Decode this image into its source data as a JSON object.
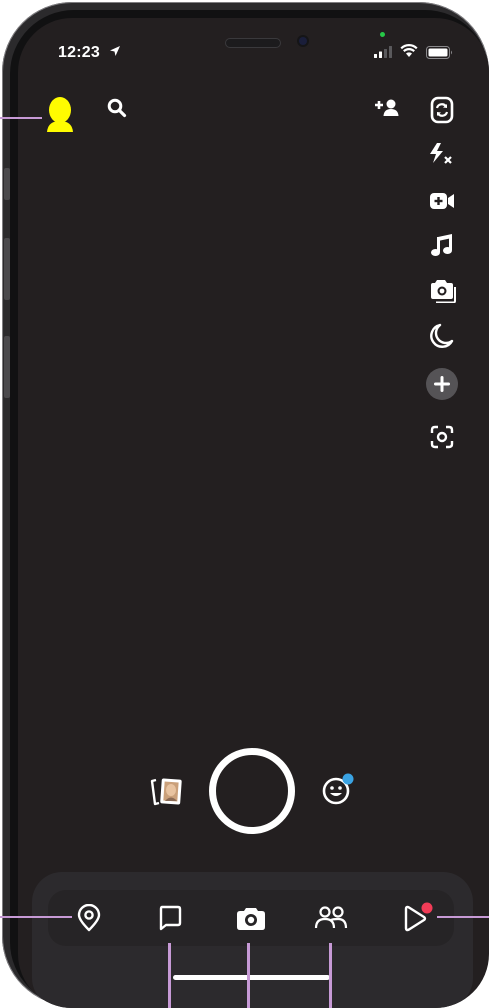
{
  "status_bar": {
    "time": "12:23",
    "icons": [
      "location-arrow-icon",
      "signal-icon",
      "wifi-icon",
      "battery-icon"
    ]
  },
  "header": {
    "icons": [
      "bitmoji-avatar-icon",
      "search-icon",
      "add-friend-icon"
    ]
  },
  "camera_toolbar": {
    "icons": [
      "flip-camera-icon",
      "flash-off-icon",
      "video-chat-icon",
      "music-icon",
      "multi-capture-icon",
      "night-mode-icon",
      "more-plus-icon",
      "scan-icon"
    ]
  },
  "capture_row": {
    "icons": [
      "memories-icon",
      "shutter-button",
      "lenses-icon"
    ]
  },
  "bottom_nav": {
    "items": [
      "map-icon",
      "chat-icon",
      "camera-icon",
      "stories-icon",
      "spotlight-icon"
    ],
    "notification_color": "#f23c57",
    "lens_badge_color": "#3aa3e3"
  },
  "colors": {
    "bitmoji": "#fffc00",
    "background": "#231f20",
    "annotation": "#c79ad6"
  }
}
